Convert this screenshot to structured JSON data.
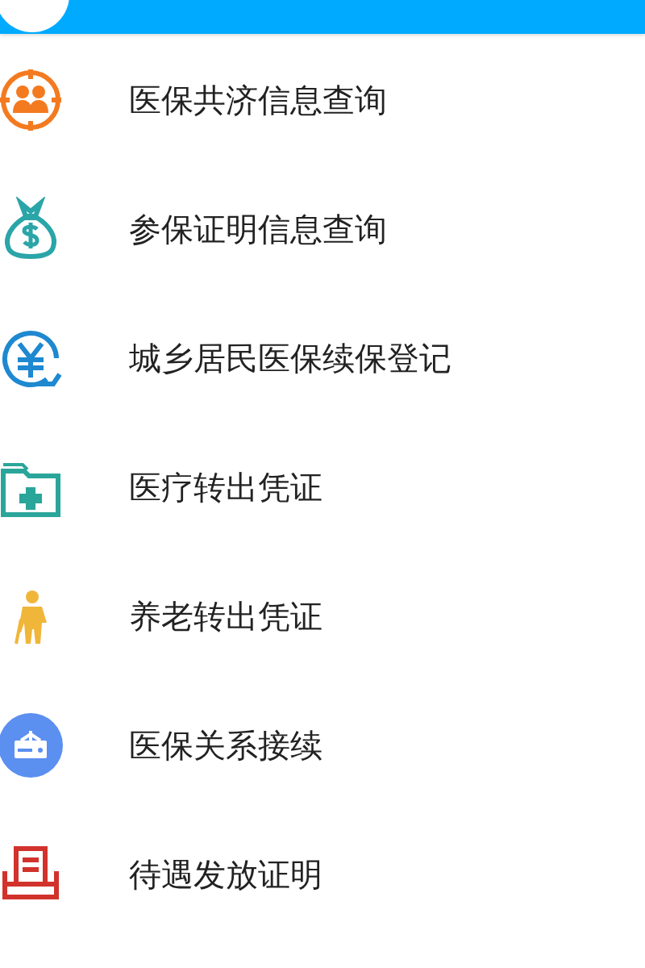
{
  "menu": [
    {
      "label": "医保共济信息查询"
    },
    {
      "label": "参保证明信息查询"
    },
    {
      "label": "城乡居民医保续保登记"
    },
    {
      "label": "医疗转出凭证"
    },
    {
      "label": "养老转出凭证"
    },
    {
      "label": "医保关系接续"
    },
    {
      "label": "待遇发放证明"
    }
  ]
}
